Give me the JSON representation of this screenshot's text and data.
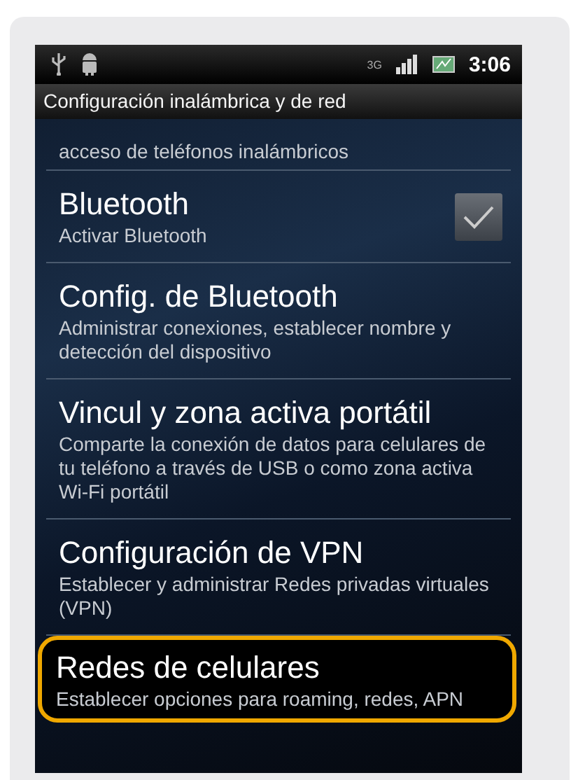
{
  "status_bar": {
    "network_type": "3G",
    "time": "3:06"
  },
  "title_bar": {
    "title": "Configuración inalámbrica y de red"
  },
  "list_top_fragment": {
    "summary": "acceso de teléfonos inalámbricos"
  },
  "items": [
    {
      "kind": "checkbox",
      "title": "Bluetooth",
      "summary": "Activar Bluetooth",
      "checked": true,
      "highlighted": false
    },
    {
      "kind": "link",
      "title": "Config. de Bluetooth",
      "summary": "Administrar conexiones, establecer nombre y detección del dispositivo",
      "highlighted": false
    },
    {
      "kind": "link",
      "title": "Vincul y zona activa portátil",
      "summary": "Comparte la conexión de datos para celulares de tu teléfono a través de USB o como zona activa Wi-Fi portátil",
      "highlighted": false
    },
    {
      "kind": "link",
      "title": "Configuración de VPN",
      "summary": "Establecer y administrar Redes privadas virtuales (VPN)",
      "highlighted": false
    },
    {
      "kind": "link",
      "title": "Redes de celulares",
      "summary": "Establecer opciones para roaming, redes, APN",
      "highlighted": true
    }
  ]
}
